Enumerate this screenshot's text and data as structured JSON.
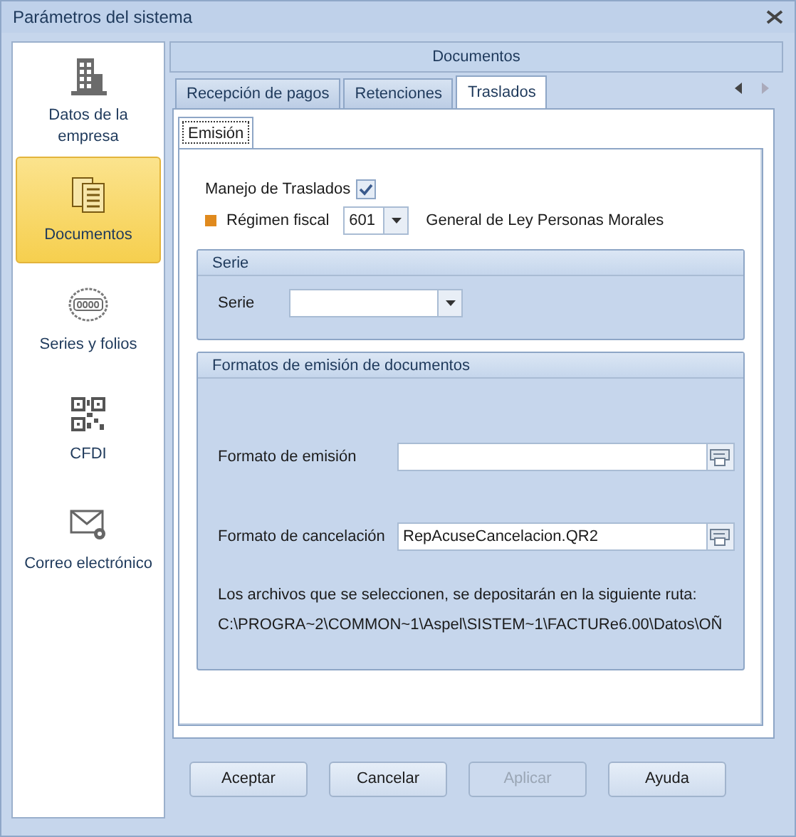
{
  "window": {
    "title": "Parámetros del sistema"
  },
  "sidebar": {
    "items": [
      {
        "label": "Datos de la empresa",
        "kind": "building",
        "selected": false
      },
      {
        "label": "Documentos",
        "kind": "documents",
        "selected": true
      },
      {
        "label": "Series y folios",
        "kind": "counter",
        "selected": false
      },
      {
        "label": "CFDI",
        "kind": "qr",
        "selected": false
      },
      {
        "label": "Correo electrónico",
        "kind": "mail",
        "selected": false
      }
    ]
  },
  "section_title": "Documentos",
  "tabs": [
    {
      "label": "Recepción de pagos",
      "selected": false
    },
    {
      "label": "Retenciones",
      "selected": false
    },
    {
      "label": "Traslados",
      "selected": true
    }
  ],
  "subtabs": [
    {
      "label": "Emisión",
      "selected": true
    }
  ],
  "traslados": {
    "label": "Manejo de Traslados",
    "checked": true
  },
  "regimen": {
    "label": "Régimen fiscal",
    "required": true,
    "code": "601",
    "description": "General de Ley Personas Morales"
  },
  "serie_group": {
    "title": "Serie",
    "label": "Serie"
  },
  "formats_group": {
    "title": "Formatos de emisión de documentos",
    "fields": [
      {
        "label": "Formato de emisión"
      },
      {
        "label": "Formato de cancelación",
        "value": "RepAcuseCancelacion.QR2"
      }
    ],
    "note": "Los archivos que se seleccionen, se depositarán en la siguiente ruta:",
    "path": "C:\\PROGRA~2\\COMMON~1\\Aspel\\SISTEM~1\\FACTURe6.00\\Datos\\OÑ"
  },
  "buttons": [
    {
      "label": "Aceptar",
      "disabled": false
    },
    {
      "label": "Cancelar",
      "disabled": false
    },
    {
      "label": "Aplicar",
      "disabled": true
    },
    {
      "label": "Ayuda",
      "disabled": false
    }
  ]
}
